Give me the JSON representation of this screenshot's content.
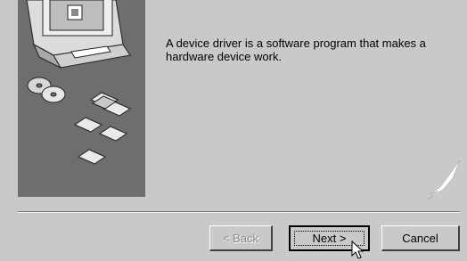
{
  "wizard": {
    "message": "A device driver is a software program that makes a hardware device work.",
    "buttons": {
      "back_label": "< Back",
      "next_label": "Next >",
      "cancel_label": "Cancel"
    },
    "states": {
      "back_enabled": false,
      "next_focused": true
    },
    "illustration": {
      "icons": [
        "computer-icon",
        "cd-disc-icon",
        "floppy-disk-icon"
      ]
    }
  }
}
